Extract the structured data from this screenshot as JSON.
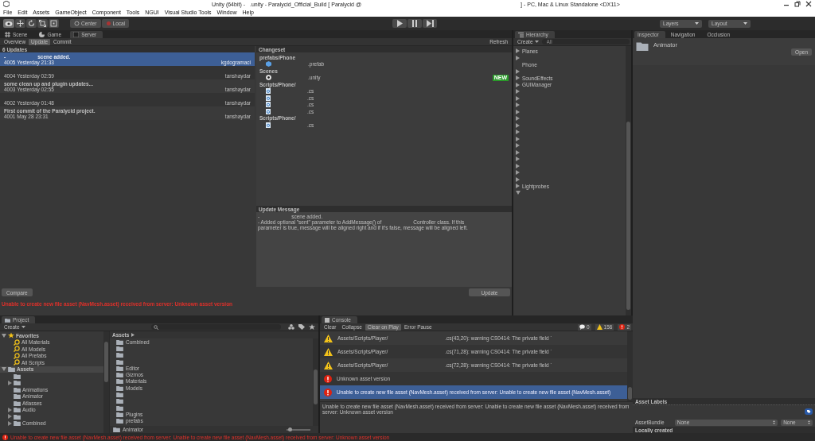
{
  "window": {
    "title_parts": [
      "Unity (64bit) -",
      ".unity - Paralycid_Official_Build [ Paralycid @",
      "] - PC, Mac & Linux Standalone <DX11>"
    ]
  },
  "menu": [
    "File",
    "Edit",
    "Assets",
    "GameObject",
    "Component",
    "Tools",
    "NGUI",
    "Visual Studio Tools",
    "Window",
    "Help"
  ],
  "toolbar": {
    "tools": [
      {
        "kind": "view",
        "selected": true
      },
      {
        "kind": "move",
        "selected": false
      },
      {
        "kind": "rotate",
        "selected": false
      },
      {
        "kind": "scale",
        "selected": false
      },
      {
        "kind": "rect",
        "selected": false
      }
    ],
    "pivot": "Center",
    "space": "Local",
    "layers": "Layers",
    "layout": "Layout"
  },
  "scene_tabs": [
    {
      "label": "Scene",
      "kind": "scene",
      "selected": false
    },
    {
      "label": "Game",
      "kind": "game",
      "selected": false
    },
    {
      "label": "Server",
      "kind": "server",
      "selected": true
    }
  ],
  "server": {
    "subtabs": [
      {
        "label": "Overview",
        "selected": false
      },
      {
        "label": "Update",
        "selected": true
      },
      {
        "label": "Commit",
        "selected": false
      }
    ],
    "refresh": "Refresh",
    "updates_title": "6 Updates",
    "updates": [
      {
        "message_parts": [
          "-",
          "scene added."
        ],
        "info": "4005 Yesterday 21:33",
        "author": "kgdogramaci",
        "selected": true
      },
      {
        "info": "4004 Yesterday 02:59",
        "author": "tanshaydar",
        "selected": false
      },
      {
        "message_parts": [
          "some clean up and plugin updates..."
        ],
        "info": "4003 Yesterday 02:55",
        "author": "tanshaydar",
        "selected": false
      },
      {
        "info": "4002 Yesterday 01:48",
        "author": "tanshaydar",
        "selected": false
      },
      {
        "message_parts": [
          "First commit of the Paralycid project."
        ],
        "info": "4001 May 28 23:31",
        "author": "tanshaydar",
        "selected": false
      }
    ],
    "changeset": {
      "title": "Changeset",
      "groups": [
        {
          "path": "prefabs/Phone",
          "files": [
            {
              "kind": "prefab",
              "name": ".prefab"
            }
          ]
        },
        {
          "path": "Scenes",
          "files": [
            {
              "kind": "scene",
              "name": ".unity",
              "badge": "NEW"
            }
          ]
        },
        {
          "path": "Scripts/Phone/",
          "files": [
            {
              "kind": "script",
              "name": ".cs"
            },
            {
              "kind": "script",
              "name": ".cs"
            },
            {
              "kind": "script",
              "name": ".cs"
            },
            {
              "kind": "script",
              "name": ".cs"
            }
          ]
        },
        {
          "path": "Scripts/Phone/",
          "files": [
            {
              "kind": "script",
              "name": ".cs"
            }
          ]
        }
      ]
    },
    "update_message": {
      "title": "Update Message",
      "lines": [
        [
          "-",
          "scene added."
        ],
        [
          "- Added optional \"sent\" parameter to AddMessage() of",
          "Controller class. If this"
        ],
        [
          "parameter is true, message will be aligned right and if it's false, message will be aligned left."
        ]
      ]
    },
    "compare": "Compare",
    "update": "Update",
    "error": "Unable to create new file asset (NavMesh.asset) received from server: Unknown asset version"
  },
  "hierarchy": {
    "tab": "Hierarchy",
    "create": "Create",
    "search_placeholder": "All",
    "items": [
      {
        "label": "Planes",
        "has_children": true,
        "expanded": false
      },
      {
        "has_children": true,
        "expanded": false
      },
      {
        "label": "Phone",
        "has_children": false
      },
      {
        "has_children": true,
        "expanded": false
      },
      {
        "label": "SoundEffects",
        "has_children": true,
        "expanded": false
      },
      {
        "label": "GUIManager",
        "has_children": true,
        "expanded": false
      },
      {
        "has_children": true,
        "expanded": false
      },
      {
        "has_children": true,
        "expanded": false
      },
      {
        "has_children": true,
        "expanded": false
      },
      {
        "has_children": true,
        "expanded": false
      },
      {
        "has_children": true,
        "expanded": false
      },
      {
        "has_children": true,
        "expanded": false
      },
      {
        "has_children": true,
        "expanded": false
      },
      {
        "has_children": true,
        "expanded": false
      },
      {
        "has_children": true,
        "expanded": false
      },
      {
        "has_children": true,
        "expanded": false
      },
      {
        "has_children": true,
        "expanded": false
      },
      {
        "has_children": true,
        "expanded": false
      },
      {
        "has_children": true,
        "expanded": false
      },
      {
        "has_children": true,
        "expanded": false
      },
      {
        "label": "Lightprobes",
        "has_children": true,
        "expanded": false
      },
      {
        "has_children": true,
        "expanded": true
      }
    ]
  },
  "inspector": {
    "tabs": [
      {
        "label": "Inspector",
        "selected": true
      },
      {
        "label": "Navigation",
        "selected": false
      },
      {
        "label": "Occlusion",
        "selected": false
      }
    ],
    "asset_name": "Animator",
    "open": "Open",
    "labels_title": "Asset Labels",
    "bundle_label": "AssetBundle",
    "bundle_value": "None",
    "variant_value": "None",
    "footer": "Locally created"
  },
  "project": {
    "tab": "Project",
    "create": "Create",
    "tree": [
      {
        "label": "Favorites",
        "kind": "favorites",
        "expanded": true,
        "selected": false,
        "children": [
          {
            "label": "All Materials",
            "kind": "search",
            "has_children": false,
            "selected": false
          },
          {
            "label": "All Models",
            "kind": "search",
            "has_children": false,
            "selected": false
          },
          {
            "label": "All Prefabs",
            "kind": "search",
            "has_children": false,
            "selected": false
          },
          {
            "label": "All Scripts",
            "kind": "search",
            "has_children": false,
            "selected": false
          }
        ]
      },
      {
        "label": "Assets",
        "kind": "folder",
        "expanded": true,
        "selected": true,
        "children": [
          {
            "kind": "folder",
            "has_children": false,
            "selected": false
          },
          {
            "kind": "folder",
            "has_children": true,
            "selected": false
          },
          {
            "label": "Animations",
            "kind": "folder",
            "has_children": false,
            "selected": false
          },
          {
            "label": "Animator",
            "kind": "folder",
            "has_children": false,
            "selected": false
          },
          {
            "label": "Atlasses",
            "kind": "folder",
            "has_children": false,
            "selected": false
          },
          {
            "label": "Audio",
            "kind": "folder",
            "has_children": true,
            "selected": false
          },
          {
            "kind": "folder",
            "has_children": true,
            "selected": false
          },
          {
            "label": "Combined",
            "kind": "folder",
            "has_children": true,
            "selected": false
          }
        ]
      }
    ],
    "breadcrumb": "Assets",
    "files": [
      {
        "label": "Combined",
        "kind": "folder"
      },
      {
        "kind": "folder"
      },
      {
        "kind": "folder"
      },
      {
        "kind": "folder"
      },
      {
        "label": "Editor",
        "kind": "folder"
      },
      {
        "label": "Gizmos",
        "kind": "folder"
      },
      {
        "label": "Materials",
        "kind": "folder"
      },
      {
        "label": "Models",
        "kind": "folder"
      },
      {
        "kind": "folder"
      },
      {
        "kind": "folder"
      },
      {
        "kind": "folder"
      },
      {
        "label": "Plugins",
        "kind": "folder"
      },
      {
        "label": "prefabs",
        "kind": "folder"
      }
    ],
    "footer_path": "Animator",
    "zoom": {
      "level": 0.05
    }
  },
  "console": {
    "tab": "Console",
    "buttons": [
      {
        "label": "Clear",
        "on": false
      },
      {
        "label": "Collapse",
        "on": false
      },
      {
        "label": "Clear on Play",
        "on": true
      },
      {
        "label": "Error Pause",
        "on": false
      }
    ],
    "counts": [
      {
        "kind": "log",
        "count": "0"
      },
      {
        "kind": "warning",
        "count": "156"
      },
      {
        "kind": "error",
        "count": "2"
      }
    ],
    "entries": [
      {
        "kind": "warning",
        "parts": [
          "Assets/Scripts/Player/",
          ".cs(43,20): warning CS0414: The private field `"
        ],
        "selected": false
      },
      {
        "kind": "warning",
        "parts": [
          "Assets/Scripts/Player/",
          ".cs(71,28): warning CS0414: The private field `"
        ],
        "selected": false
      },
      {
        "kind": "warning",
        "parts": [
          "Assets/Scripts/Player/",
          ".cs(72,28): warning CS0414: The private field `"
        ],
        "selected": false
      },
      {
        "kind": "error",
        "parts": [
          "Unknown asset version"
        ],
        "selected": false
      },
      {
        "kind": "error",
        "parts": [
          "Unable to create new file asset (NavMesh.asset) received from server: Unable to create new file asset (NavMesh.asset)"
        ],
        "selected": true
      }
    ],
    "detail": "Unable to create new file asset (NavMesh.asset) received from server: Unable to create new file asset (NavMesh.asset) received from server: Unknown asset version"
  },
  "status_bar": {
    "text": "Unable to create new file asset (NavMesh.asset) received from server: Unable to create new file asset (NavMesh.asset) received from server: Unknown asset version"
  }
}
